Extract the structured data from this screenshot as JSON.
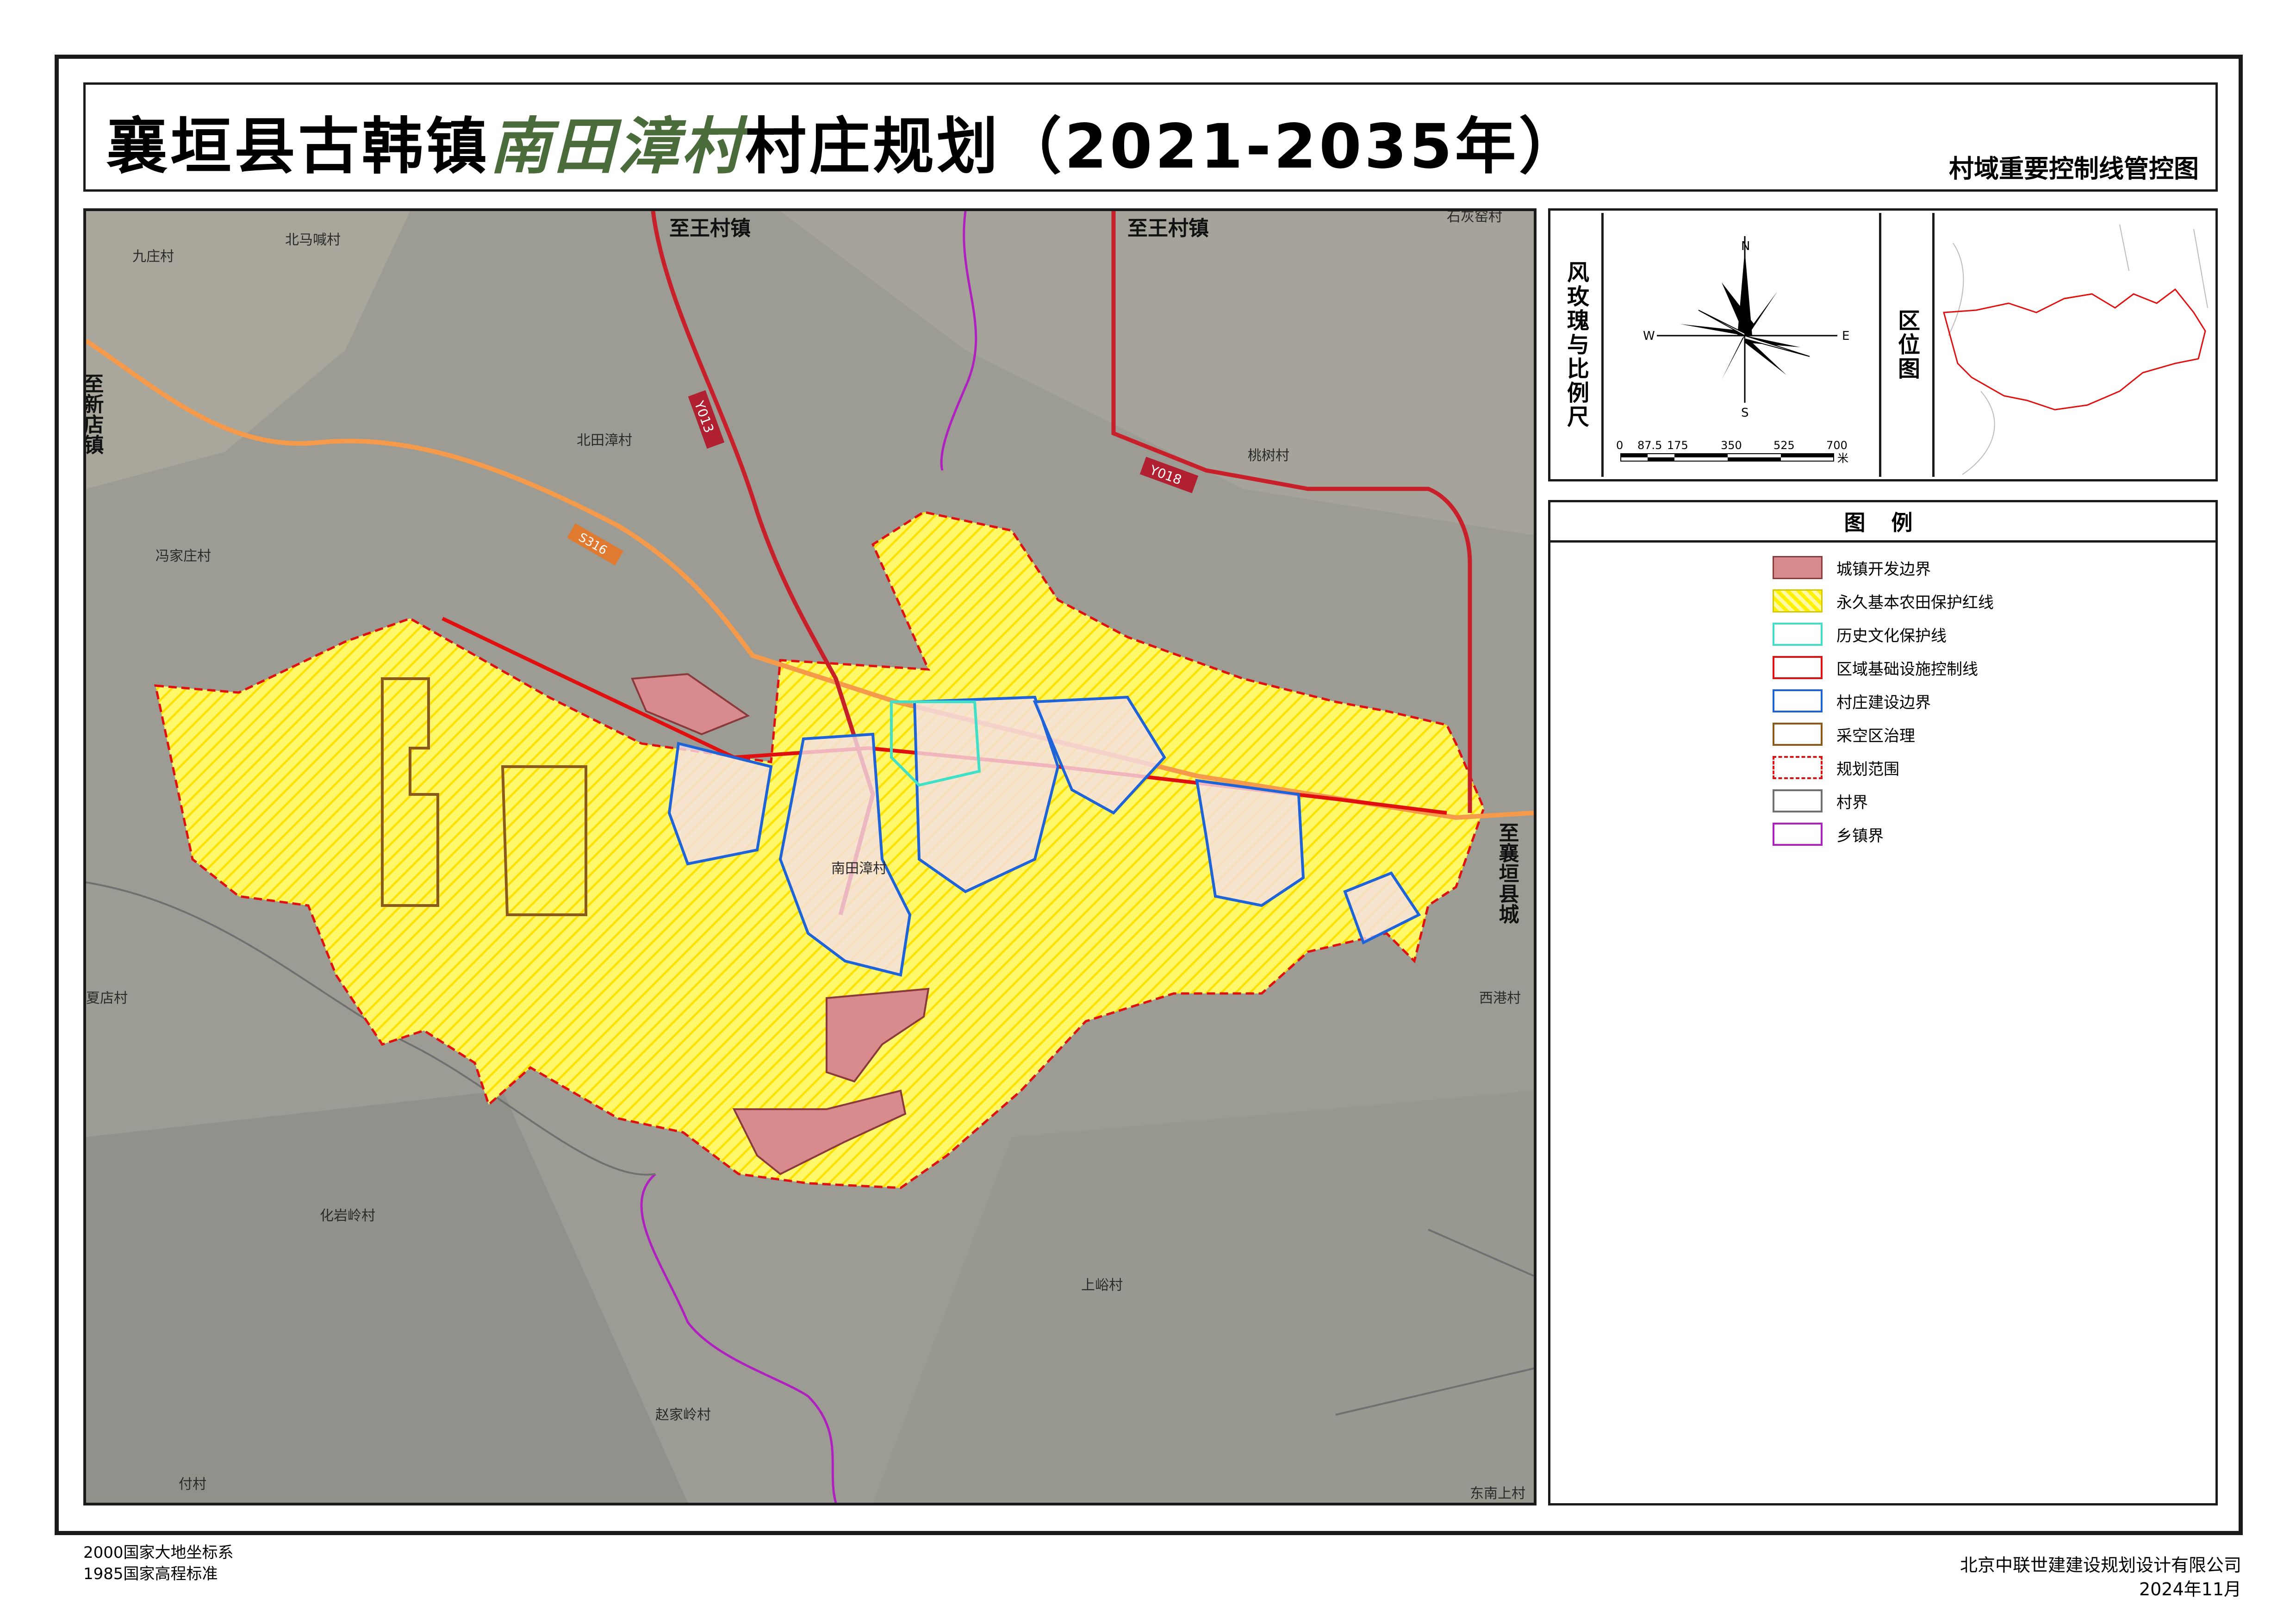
{
  "title": {
    "prefix": "襄垣县古韩镇",
    "village": "南田漳村",
    "suffix": "村庄规划（2021-2035年）",
    "subtitle": "村域重要控制线管控图"
  },
  "map": {
    "place_labels": [
      "北马喊村",
      "九庄村",
      "北田漳村",
      "冯家庄村",
      "桃树村",
      "石灰窑村",
      "南田漳村",
      "夏店村",
      "西港村",
      "化岩岭村",
      "上峪村",
      "赵家岭村",
      "付村",
      "东南上村"
    ],
    "direction_labels": {
      "north_left": "至王村镇",
      "north_right": "至王村镇",
      "west": "至新店镇",
      "east": "至襄垣县城"
    },
    "road_codes": [
      "Y013",
      "Y018",
      "S316"
    ]
  },
  "compass": {
    "caption": "风玫瑰与比例尺",
    "directions": {
      "n": "N",
      "s": "S",
      "e": "E",
      "w": "W"
    },
    "scale_ticks": [
      "0",
      "87.5",
      "175",
      "350",
      "525",
      "700"
    ],
    "scale_unit": "米"
  },
  "location_map": {
    "caption": "区位图"
  },
  "legend": {
    "title": "图 例",
    "items": [
      {
        "label": "城镇开发边界",
        "fill": "#d98a8c",
        "stroke": "#8a3a3a",
        "style": "solid-fill"
      },
      {
        "label": "永久基本农田保护红线",
        "fill": "#fff200",
        "stroke": "#d8c800",
        "style": "hatch"
      },
      {
        "label": "历史文化保护线",
        "fill": "none",
        "stroke": "#40e0c8",
        "style": "outline"
      },
      {
        "label": "区域基础设施控制线",
        "fill": "none",
        "stroke": "#e01010",
        "style": "outline"
      },
      {
        "label": "村庄建设边界",
        "fill": "none",
        "stroke": "#1e64d8",
        "style": "outline"
      },
      {
        "label": "采空区治理",
        "fill": "none",
        "stroke": "#8b5a1a",
        "style": "outline"
      },
      {
        "label": "规划范围",
        "fill": "none",
        "stroke": "#e01010",
        "style": "dashed"
      },
      {
        "label": "村界",
        "fill": "none",
        "stroke": "#707070",
        "style": "outline"
      },
      {
        "label": "乡镇界",
        "fill": "none",
        "stroke": "#b020c0",
        "style": "outline"
      }
    ]
  },
  "footer": {
    "coord_system": "2000国家大地坐标系",
    "height_system": "1985国家高程标准",
    "company": "北京中联世建建设规划设计有限公司",
    "date": "2024年11月"
  }
}
